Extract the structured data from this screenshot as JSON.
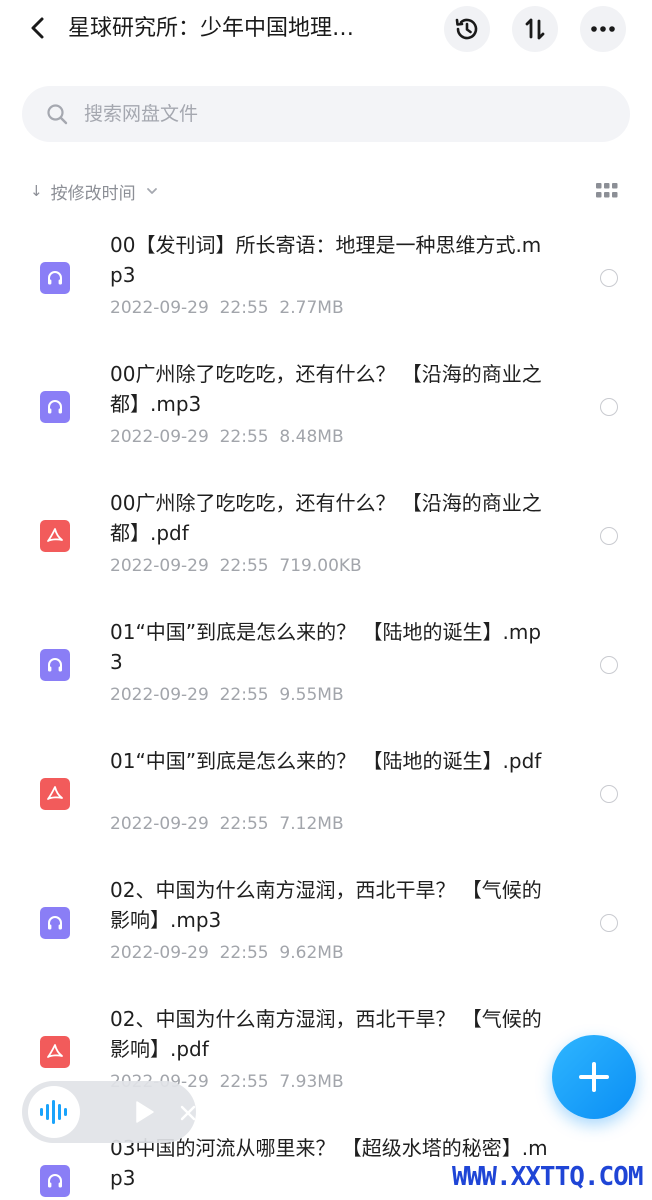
{
  "header": {
    "title": "星球研究所：少年中国地理…",
    "sort_button_label": "⇅"
  },
  "search": {
    "placeholder": "搜索网盘文件"
  },
  "sort_bar": {
    "label": "按修改时间",
    "arrow": "↓"
  },
  "files": [
    {
      "name": "00【发刊词】所长寄语：地理是一种思维方式.mp3",
      "date": "2022-09-29",
      "time": "22:55",
      "size": "2.77MB",
      "type": "audio"
    },
    {
      "name": "00广州除了吃吃吃，还有什么？ 【沿海的商业之都】.mp3",
      "date": "2022-09-29",
      "time": "22:55",
      "size": "8.48MB",
      "type": "audio"
    },
    {
      "name": "00广州除了吃吃吃，还有什么？ 【沿海的商业之都】.pdf",
      "date": "2022-09-29",
      "time": "22:55",
      "size": "719.00KB",
      "type": "pdf"
    },
    {
      "name": "01“中国”到底是怎么来的？ 【陆地的诞生】.mp3",
      "date": "2022-09-29",
      "time": "22:55",
      "size": "9.55MB",
      "type": "audio"
    },
    {
      "name": "01“中国”到底是怎么来的？ 【陆地的诞生】.pdf",
      "date": "2022-09-29",
      "time": "22:55",
      "size": "7.12MB",
      "type": "pdf"
    },
    {
      "name": "02、中国为什么南方湿润，西北干旱？ 【气候的影响】.mp3",
      "date": "2022-09-29",
      "time": "22:55",
      "size": "9.62MB",
      "type": "audio"
    },
    {
      "name": "02、中国为什么南方湿润，西北干旱？ 【气候的影响】.pdf",
      "date": "2022-09-29",
      "time": "22:55",
      "size": "7.93MB",
      "type": "pdf"
    },
    {
      "name": "03中国的河流从哪里来？ 【超级水塔的秘密】.mp3",
      "date": "",
      "time": "",
      "size": "",
      "type": "audio"
    }
  ],
  "colors": {
    "audio_icon": "#8a7ef6",
    "pdf_icon": "#f25b5b",
    "fab": "#1aa3fb",
    "meta_text": "#a2a5ab"
  },
  "icons": {
    "back": "chevron-left-icon",
    "history": "clock-history-icon",
    "sort": "sort-arrows-icon",
    "more": "more-dots-icon",
    "search": "search-icon",
    "grid": "grid-view-icon",
    "audio_file": "headphones-icon",
    "pdf_file": "pdf-icon",
    "add": "plus-icon",
    "wave": "audio-wave-icon",
    "play": "play-icon",
    "close": "close-icon"
  },
  "watermark": "WWW.XXTTQ.COM"
}
